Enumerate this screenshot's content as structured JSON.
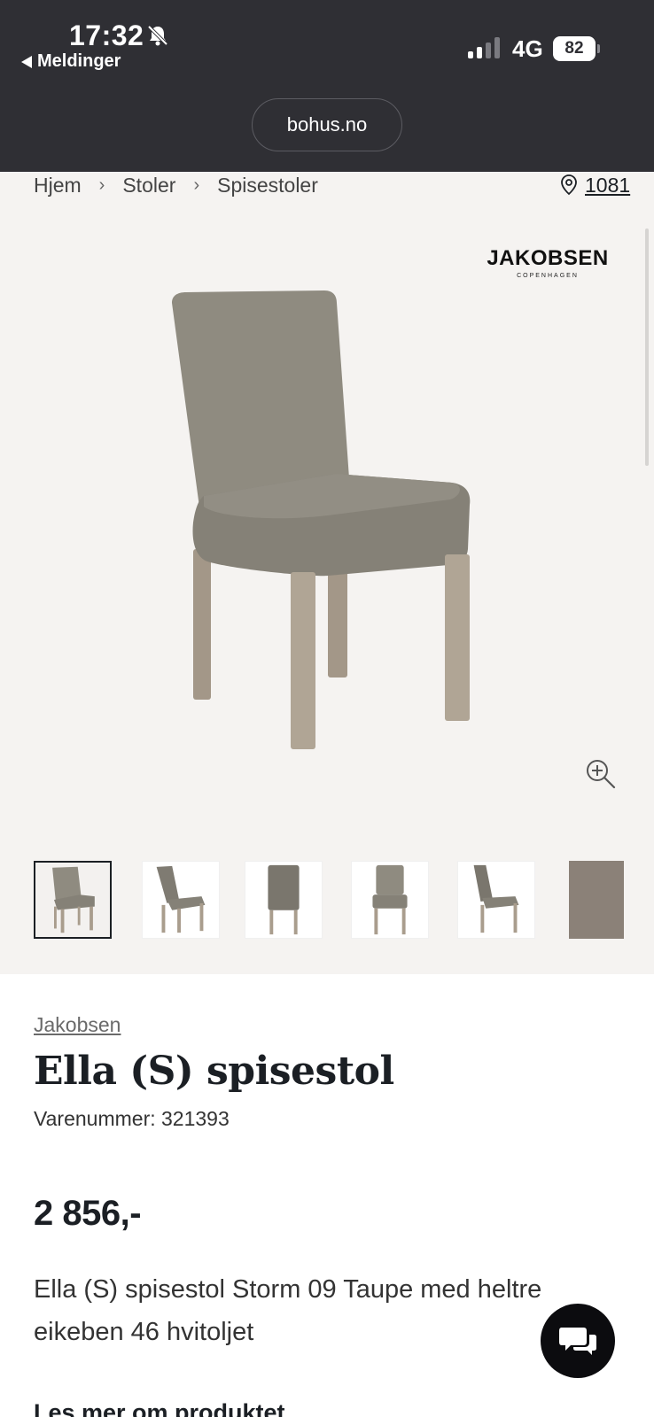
{
  "status_bar": {
    "time": "17:32",
    "back_label": "Meldinger",
    "network": "4G",
    "battery": "82"
  },
  "browser": {
    "url": "bohus.no"
  },
  "breadcrumb": {
    "items": [
      "Hjem",
      "Stoler",
      "Spisestoler"
    ],
    "separator": "›"
  },
  "store": {
    "number": "1081",
    "icon": "location-pin-icon"
  },
  "brand_logo": {
    "main": "JAKOBSEN",
    "sub": "COPENHAGEN"
  },
  "gallery": {
    "thumbnails_count_visible": 6,
    "selected_index": 0
  },
  "product": {
    "brand": "Jakobsen",
    "title": "Ella (S) spisestol",
    "sku": "Varenummer: 321393",
    "price": "2 856,-",
    "description": "Ella (S) spisestol Storm 09 Taupe med heltre eikeben 46 hvitoljet",
    "read_more": "Les mer om produktet"
  },
  "colors": {
    "header_bg": "#2f2f34",
    "page_bg": "#f5f3f1",
    "text": "#1b1f24",
    "chat_button": "#0c0c0f",
    "fabric": "#8b8178"
  }
}
